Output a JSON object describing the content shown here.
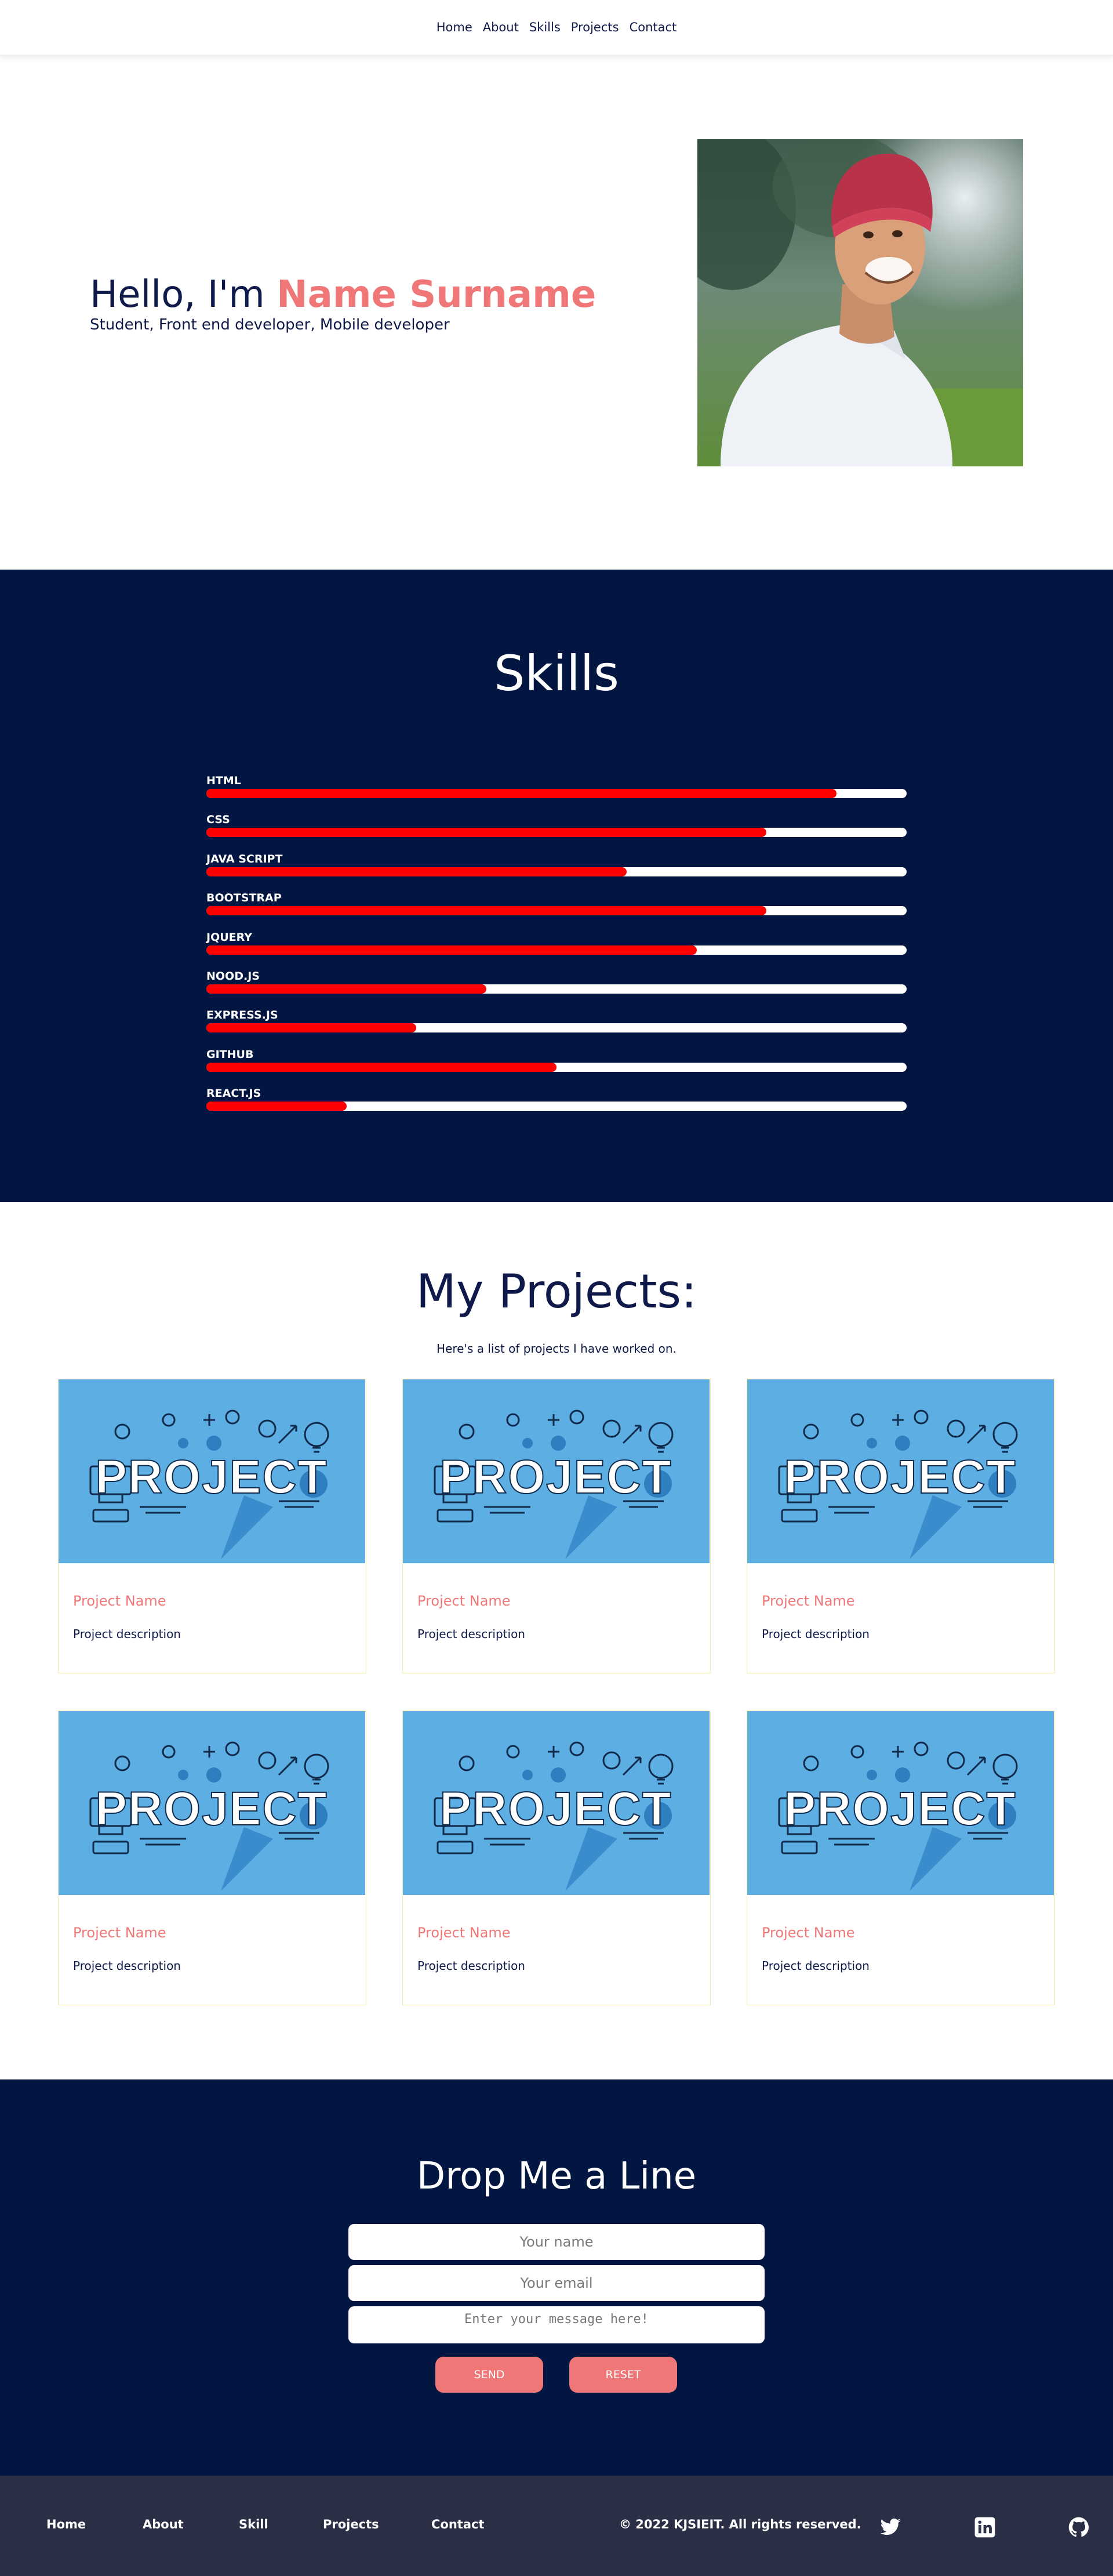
{
  "nav": {
    "items": [
      "Home",
      "About",
      "Skills",
      "Projects",
      "Contact"
    ]
  },
  "hero": {
    "greeting": "Hello, I'm ",
    "name": "Name Surname",
    "subtitle": "Student, Front end developer, Mobile developer",
    "photo_icon": "portrait-photo"
  },
  "skills": {
    "title": "Skills",
    "items": [
      {
        "label": "HTML",
        "level": 0.9
      },
      {
        "label": "CSS",
        "level": 0.8
      },
      {
        "label": "JAVA SCRIPT",
        "level": 0.6
      },
      {
        "label": "BOOTSTRAP",
        "level": 0.8
      },
      {
        "label": "JQUERY",
        "level": 0.7
      },
      {
        "label": "NOOD.JS",
        "level": 0.4
      },
      {
        "label": "EXPRESS.JS",
        "level": 0.3
      },
      {
        "label": "GITHUB",
        "level": 0.5
      },
      {
        "label": "REACT.JS",
        "level": 0.2
      }
    ]
  },
  "projects": {
    "title": "My Projects:",
    "subtitle": "Here's a list of projects I have worked on.",
    "cards": [
      {
        "name": "Project Name",
        "description": "Project description",
        "image_text": "PROJECT"
      },
      {
        "name": "Project Name",
        "description": "Project description",
        "image_text": "PROJECT"
      },
      {
        "name": "Project Name",
        "description": "Project description",
        "image_text": "PROJECT"
      },
      {
        "name": "Project Name",
        "description": "Project description",
        "image_text": "PROJECT"
      },
      {
        "name": "Project Name",
        "description": "Project description",
        "image_text": "PROJECT"
      },
      {
        "name": "Project Name",
        "description": "Project description",
        "image_text": "PROJECT"
      }
    ]
  },
  "contact": {
    "title": "Drop Me a Line",
    "name_placeholder": "Your name",
    "email_placeholder": "Your email",
    "message_placeholder": "Enter your message here!",
    "send_label": "SEND",
    "reset_label": "RESET"
  },
  "footer": {
    "links": [
      "Home",
      "About",
      "Skill",
      "Projects",
      "Contact"
    ],
    "copyright": "© 2022 KJSIEIT. All rights reserved.",
    "social_icons": [
      "twitter-icon",
      "linkedin-icon",
      "github-icon"
    ]
  },
  "colors": {
    "navy": "#031642",
    "accent": "#f07777",
    "skill_fill": "#ff0000",
    "project_bg": "#5daee3",
    "footer_bg": "#2a2f45"
  }
}
